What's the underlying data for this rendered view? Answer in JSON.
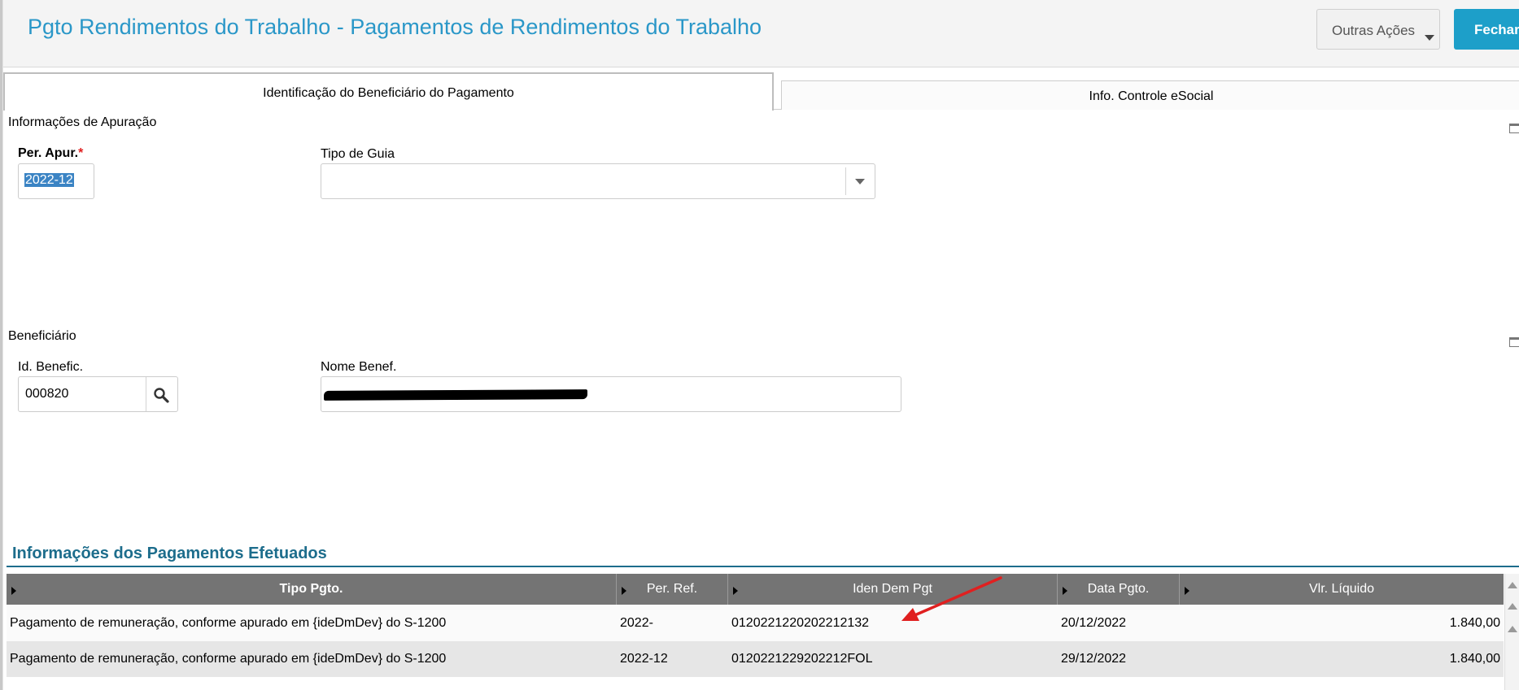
{
  "header": {
    "title": "Pgto Rendimentos do Trabalho - Pagamentos de Rendimentos do Trabalho",
    "other_actions": "Outras Ações",
    "close": "Fechar"
  },
  "tabs": [
    {
      "label": "Identificação do Beneficiário do Pagamento",
      "active": true
    },
    {
      "label": "Info. Controle eSocial",
      "active": false
    }
  ],
  "apuracao": {
    "section": "Informações de Apuração",
    "per_apur_label": "Per. Apur.",
    "required_mark": "*",
    "per_apur_value": "2022-12",
    "tipo_guia_label": "Tipo de Guia",
    "tipo_guia_value": ""
  },
  "beneficiario": {
    "section": "Beneficiário",
    "id_label": "Id. Benefic.",
    "id_value": "000820",
    "nome_label": "Nome Benef.",
    "nome_value": ""
  },
  "grid": {
    "title": "Informações dos Pagamentos Efetuados",
    "columns": [
      "Tipo Pgto.",
      "Per. Ref.",
      "Iden Dem Pgt",
      "Data Pgto.",
      "Vlr. Líquido"
    ],
    "rows": [
      [
        "Pagamento de remuneração, conforme apurado em {ideDmDev} do S-1200",
        "2022-",
        "012022122020221213​2",
        "20/12/2022",
        "1.840,00"
      ],
      [
        "Pagamento de remuneração, conforme apurado em {ideDmDev} do S-1200",
        "2022-12",
        "012022122920221​2FOL",
        "29/12/2022",
        "1.840,00"
      ]
    ]
  },
  "colors": {
    "accent": "#2a97c8",
    "primary_button": "#1d9fc9",
    "section_title": "#1d6d8c",
    "annotation_arrow": "#e02020"
  },
  "icons": {
    "lookup": "search-icon",
    "dropdown": "chevron-down-icon",
    "collapse": "panel-collapse-icon"
  }
}
